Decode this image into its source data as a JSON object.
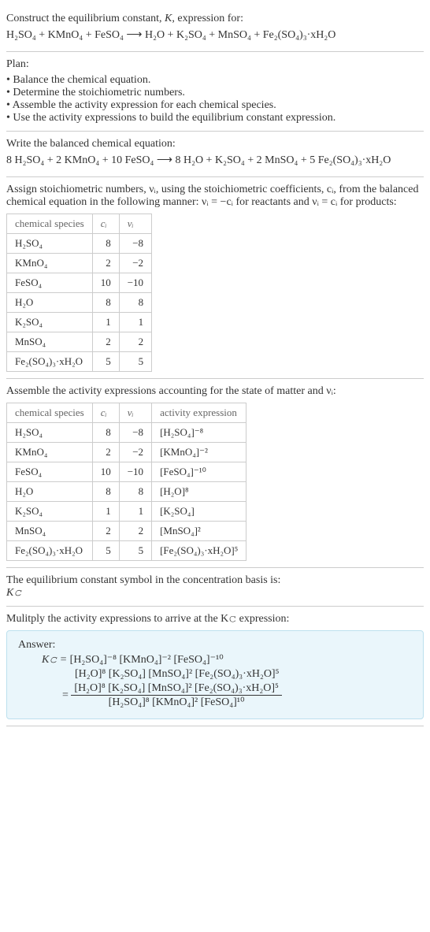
{
  "header": {
    "title_pre": "Construct the equilibrium constant, ",
    "title_K": "K",
    "title_post": ", expression for:",
    "equation": "H₂SO₄ + KMnO₄ + FeSO₄ ⟶ H₂O + K₂SO₄ + MnSO₄ + Fe₂(SO₄)₃·xH₂O"
  },
  "plan": {
    "label": "Plan:",
    "items": [
      "Balance the chemical equation.",
      "Determine the stoichiometric numbers.",
      "Assemble the activity expression for each chemical species.",
      "Use the activity expressions to build the equilibrium constant expression."
    ]
  },
  "balanced": {
    "intro": "Write the balanced chemical equation:",
    "equation": "8 H₂SO₄ + 2 KMnO₄ + 10 FeSO₄ ⟶ 8 H₂O + K₂SO₄ + 2 MnSO₄ + 5 Fe₂(SO₄)₃·xH₂O"
  },
  "stoich": {
    "intro": "Assign stoichiometric numbers, νᵢ, using the stoichiometric coefficients, cᵢ, from the balanced chemical equation in the following manner: νᵢ = −cᵢ for reactants and νᵢ = cᵢ for products:",
    "headers": {
      "species": "chemical species",
      "c": "cᵢ",
      "v": "νᵢ"
    },
    "rows": [
      {
        "species": "H₂SO₄",
        "c": "8",
        "v": "−8"
      },
      {
        "species": "KMnO₄",
        "c": "2",
        "v": "−2"
      },
      {
        "species": "FeSO₄",
        "c": "10",
        "v": "−10"
      },
      {
        "species": "H₂O",
        "c": "8",
        "v": "8"
      },
      {
        "species": "K₂SO₄",
        "c": "1",
        "v": "1"
      },
      {
        "species": "MnSO₄",
        "c": "2",
        "v": "2"
      },
      {
        "species": "Fe₂(SO₄)₃·xH₂O",
        "c": "5",
        "v": "5"
      }
    ]
  },
  "activity": {
    "intro": "Assemble the activity expressions accounting for the state of matter and νᵢ:",
    "headers": {
      "species": "chemical species",
      "c": "cᵢ",
      "v": "νᵢ",
      "expr": "activity expression"
    },
    "rows": [
      {
        "species": "H₂SO₄",
        "c": "8",
        "v": "−8",
        "expr": "[H₂SO₄]⁻⁸"
      },
      {
        "species": "KMnO₄",
        "c": "2",
        "v": "−2",
        "expr": "[KMnO₄]⁻²"
      },
      {
        "species": "FeSO₄",
        "c": "10",
        "v": "−10",
        "expr": "[FeSO₄]⁻¹⁰"
      },
      {
        "species": "H₂O",
        "c": "8",
        "v": "8",
        "expr": "[H₂O]⁸"
      },
      {
        "species": "K₂SO₄",
        "c": "1",
        "v": "1",
        "expr": "[K₂SO₄]"
      },
      {
        "species": "MnSO₄",
        "c": "2",
        "v": "2",
        "expr": "[MnSO₄]²"
      },
      {
        "species": "Fe₂(SO₄)₃·xH₂O",
        "c": "5",
        "v": "5",
        "expr": "[Fe₂(SO₄)₃·xH₂O]⁵"
      }
    ]
  },
  "symbol": {
    "intro": "The equilibrium constant symbol in the concentration basis is:",
    "value": "K𝚌"
  },
  "multiply": {
    "intro": "Mulitply the activity expressions to arrive at the K𝚌 expression:"
  },
  "answer": {
    "label": "Answer:",
    "line1_lhs": "K𝚌 = ",
    "line1": "[H₂SO₄]⁻⁸ [KMnO₄]⁻² [FeSO₄]⁻¹⁰",
    "line2_indent": "          ",
    "line2": "[H₂O]⁸ [K₂SO₄] [MnSO₄]² [Fe₂(SO₄)₃·xH₂O]⁵",
    "eq": "= ",
    "frac_num": "[H₂O]⁸ [K₂SO₄] [MnSO₄]² [Fe₂(SO₄)₃·xH₂O]⁵",
    "frac_den": "[H₂SO₄]⁸ [KMnO₄]² [FeSO₄]¹⁰"
  }
}
